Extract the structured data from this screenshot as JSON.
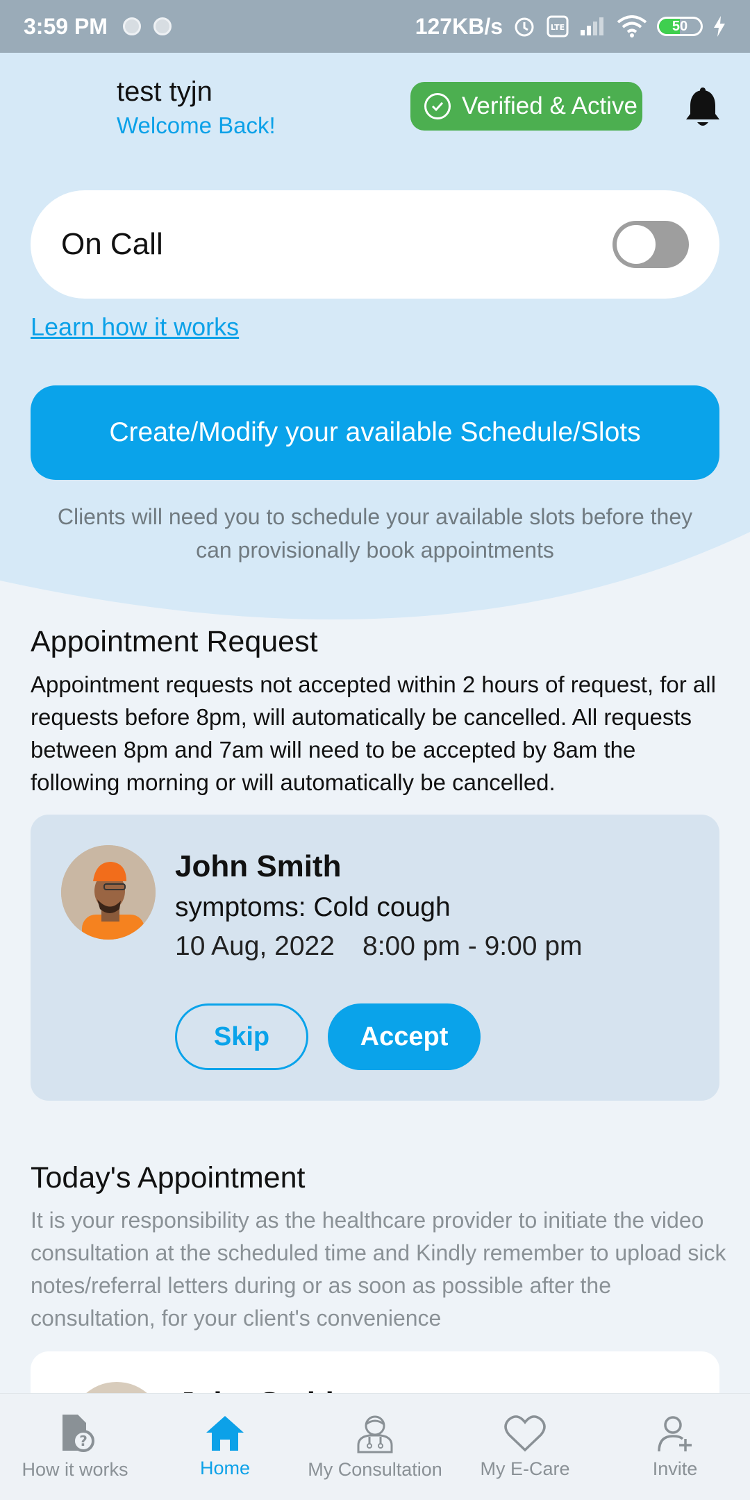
{
  "status_bar": {
    "time": "3:59 PM",
    "speed": "127KB/s",
    "battery": "50"
  },
  "header": {
    "user_name": "test tyjn",
    "welcome": "Welcome Back!",
    "verified_label": "Verified & Active",
    "icons": [
      "check-circle-icon",
      "bell-icon"
    ]
  },
  "on_call": {
    "label": "On Call",
    "enabled": false
  },
  "learn_link": "Learn how it works",
  "schedule": {
    "button_label": "Create/Modify your available Schedule/Slots",
    "note": "Clients will need you to schedule your available slots before they can provisionally book appointments"
  },
  "appointment_request": {
    "title": "Appointment Request",
    "description": "Appointment requests not accepted within 2 hours of request, for all requests before 8pm, will automatically be cancelled. All requests between 8pm and 7am will need to be accepted by 8am the following morning or will automatically be cancelled.",
    "card": {
      "name": "John Smith",
      "symptoms": "symptoms: Cold cough",
      "date": "10 Aug, 2022",
      "time": "8:00 pm - 9:00 pm",
      "skip_label": "Skip",
      "accept_label": "Accept"
    }
  },
  "todays_appointment": {
    "title": "Today's Appointment",
    "description": "It is your responsibility as the healthcare provider to initiate the video consultation at the scheduled time and Kindly remember to upload sick notes/referral letters during or as soon as possible after the consultation, for your client's convenience",
    "card_name": "John Smith"
  },
  "bottom_nav": {
    "items": [
      {
        "label": "How it works",
        "icon": "document-question-icon",
        "active": false
      },
      {
        "label": "Home",
        "icon": "home-icon",
        "active": true
      },
      {
        "label": "My Consultation",
        "icon": "doctor-icon",
        "active": false
      },
      {
        "label": "My E-Care",
        "icon": "heart-icon",
        "active": false
      },
      {
        "label": "Invite",
        "icon": "add-user-icon",
        "active": false
      }
    ]
  },
  "colors": {
    "accent": "#0aa3ea",
    "verified_green": "#4caf50",
    "hero_bg": "#d6e9f7"
  }
}
